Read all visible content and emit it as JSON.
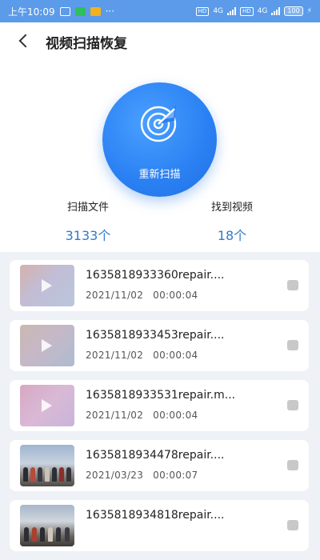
{
  "status_bar": {
    "time": "上午10:09",
    "dots": "···",
    "hd1": "HD",
    "hd2": "HD",
    "net1": "4G",
    "net2": "4G",
    "battery": "100"
  },
  "header": {
    "title": "视频扫描恢复",
    "scan_button_label": "重新扫描"
  },
  "stats": {
    "scanned_label": "扫描文件",
    "scanned_value": "3133个",
    "found_label": "找到视频",
    "found_value": "18个"
  },
  "videos": [
    {
      "name": "1635818933360repair....",
      "date": "2021/11/02",
      "duration": "00:00:04"
    },
    {
      "name": "1635818933453repair....",
      "date": "2021/11/02",
      "duration": "00:00:04"
    },
    {
      "name": "1635818933531repair.m...",
      "date": "2021/11/02",
      "duration": "00:00:04"
    },
    {
      "name": "1635818934478repair....",
      "date": "2021/03/23",
      "duration": "00:00:07"
    },
    {
      "name": "1635818934818repair....",
      "date": "",
      "duration": ""
    }
  ],
  "colors": {
    "status_bar": "#5b9bea",
    "accent": "#2a80f2",
    "stat_value": "#3479c9"
  }
}
